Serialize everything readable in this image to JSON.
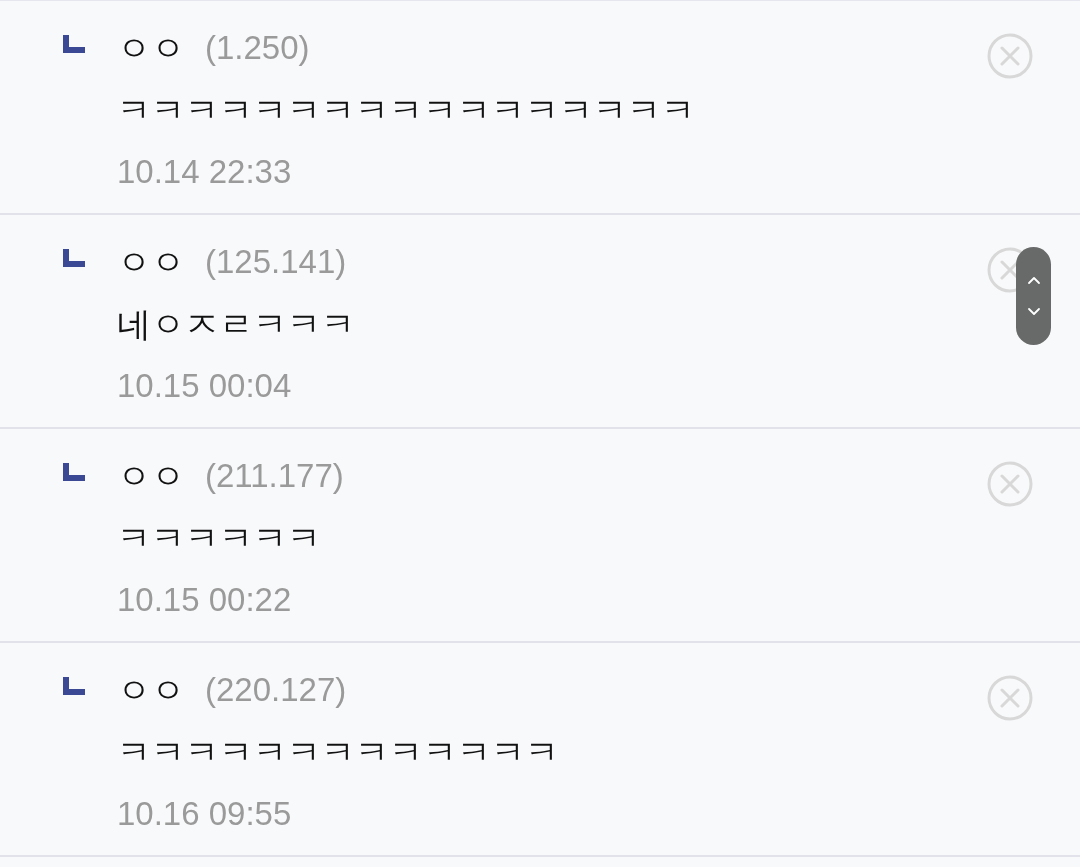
{
  "comments": [
    {
      "author": "ㅇㅇ",
      "ip": "(1.250)",
      "text": "ㅋㅋㅋㅋㅋㅋㅋㅋㅋㅋㅋㅋㅋㅋㅋㅋㅋ",
      "time": "10.14 22:33"
    },
    {
      "author": "ㅇㅇ",
      "ip": "(125.141)",
      "text": "네ㅇㅈㄹㅋㅋㅋ",
      "time": "10.15 00:04"
    },
    {
      "author": "ㅇㅇ",
      "ip": "(211.177)",
      "text": "ㅋㅋㅋㅋㅋㅋ",
      "time": "10.15 00:22"
    },
    {
      "author": "ㅇㅇ",
      "ip": "(220.127)",
      "text": "ㅋㅋㅋㅋㅋㅋㅋㅋㅋㅋㅋㅋㅋ",
      "time": "10.16 09:55"
    }
  ]
}
